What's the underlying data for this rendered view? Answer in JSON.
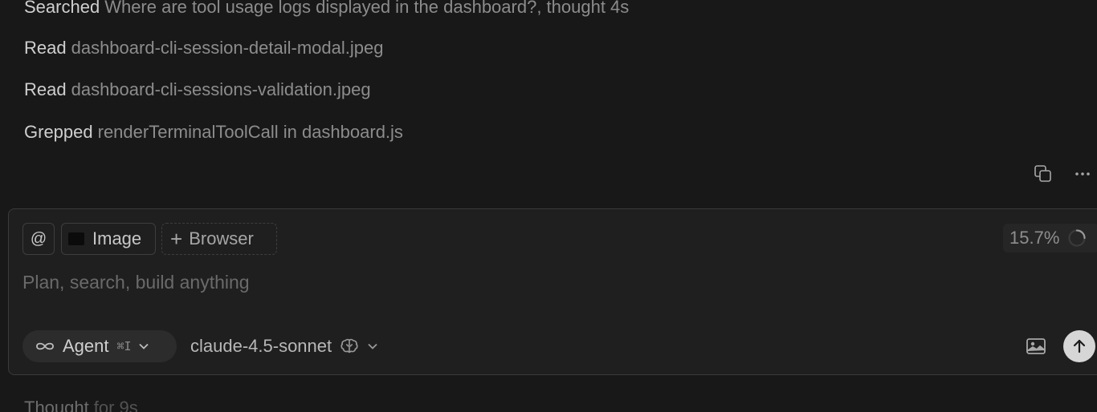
{
  "log": [
    {
      "verb": "Searched",
      "target": "Where are tool usage logs displayed in the dashboard?, thought 4s"
    },
    {
      "verb": "Read",
      "target": "dashboard-cli-session-detail-modal.jpeg"
    },
    {
      "verb": "Read",
      "target": "dashboard-cli-sessions-validation.jpeg"
    },
    {
      "verb": "Grepped",
      "target": "renderTerminalToolCall in dashboard.js"
    }
  ],
  "message_actions": {
    "copy_icon": "copy-icon",
    "more_icon": "more-icon"
  },
  "composer": {
    "mention_symbol": "@",
    "image_chip_label": "Image",
    "browser_chip_label": "Browser",
    "browser_plus": "+",
    "context_usage": "15.7%",
    "placeholder": "Plan, search, build anything",
    "mode_label": "Agent",
    "mode_shortcut": "⌘I",
    "model_label": "claude-4.5-sonnet"
  },
  "thought": {
    "label": "Thought",
    "duration": "for 9s"
  },
  "colors": {
    "background": "#181818",
    "composer_bg": "#1f1f1f",
    "send_button": "#d6d6d6"
  }
}
